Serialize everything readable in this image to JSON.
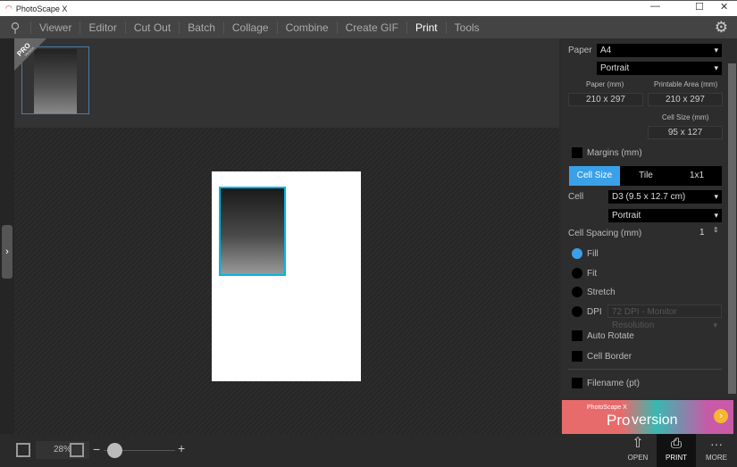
{
  "window": {
    "title": "PhotoScape X",
    "minimize": "—",
    "maximize": "☐",
    "close": "✕"
  },
  "menu": [
    {
      "label": "Viewer"
    },
    {
      "label": "Editor"
    },
    {
      "label": "Cut Out"
    },
    {
      "label": "Batch"
    },
    {
      "label": "Collage"
    },
    {
      "label": "Combine"
    },
    {
      "label": "Create GIF"
    },
    {
      "label": "Print",
      "active": true
    },
    {
      "label": "Tools"
    }
  ],
  "thumb": {
    "badge": "PRO",
    "badge_sub": "Version"
  },
  "panel": {
    "paper_label": "Paper",
    "paper": "A4",
    "orientation": "Portrait",
    "paper_mm_label": "Paper (mm)",
    "paper_mm": "210 x 297",
    "printable_label": "Printable Area (mm)",
    "printable": "210 x 297",
    "cell_size_label": "Cell Size (mm)",
    "cell_size": "95 x 127",
    "margins": "Margins (mm)",
    "modes": [
      "Cell Size",
      "Tile",
      "1x1"
    ],
    "active_mode": "Cell Size",
    "cell_label": "Cell",
    "cell": "D3 (9.5 x 12.7 cm)",
    "cell_orientation": "Portrait",
    "spacing_label": "Cell Spacing (mm)",
    "spacing": "1",
    "fit_options": [
      "Fill",
      "Fit",
      "Stretch",
      "DPI"
    ],
    "selected_fit": "Fill",
    "dpi": "72 DPI - Monitor Resolution",
    "auto_rotate": "Auto Rotate",
    "cell_border": "Cell Border",
    "filename": "Filename (pt)"
  },
  "promo": {
    "small": "PhotoScape X",
    "big": "Pro",
    "rest": "version"
  },
  "bottom": {
    "zoom": "28%",
    "open": "OPEN",
    "print": "PRINT",
    "more": "MORE",
    "zoom_level": 0.15
  },
  "colors": {
    "accent": "#3aa0e8",
    "selection": "#00b4e6"
  }
}
